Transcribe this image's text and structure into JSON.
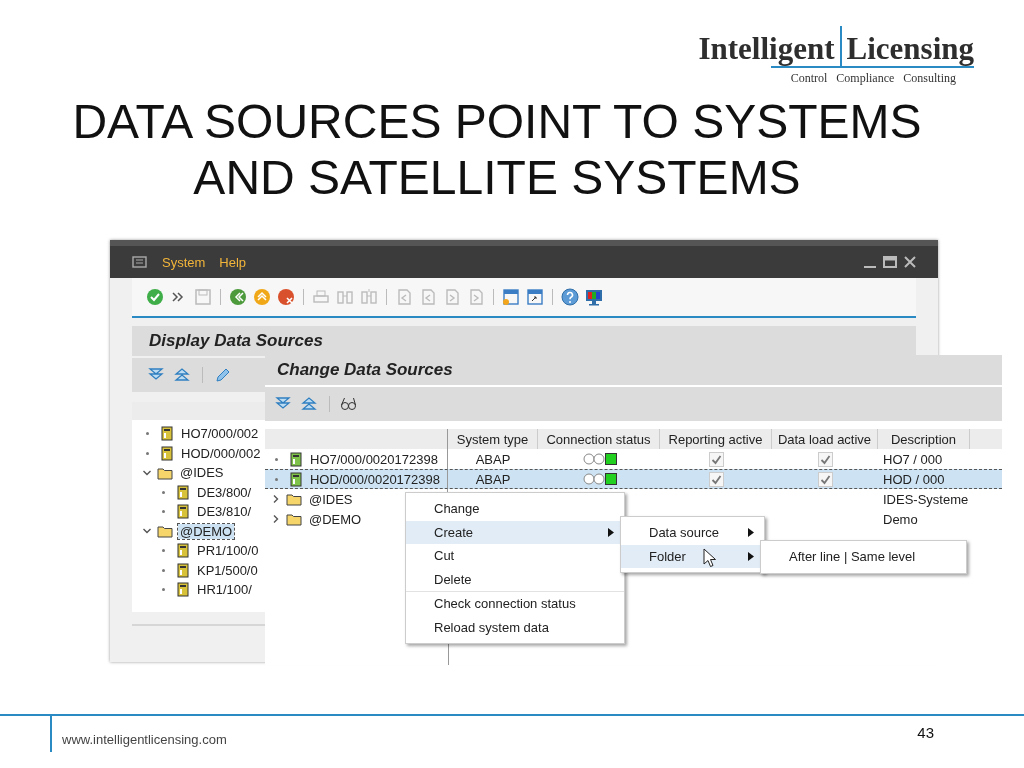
{
  "logo": {
    "name_parts": [
      "Intelligent",
      "Licensing"
    ],
    "tagline": [
      "Control",
      "Compliance",
      "Consulting"
    ]
  },
  "title_lines": [
    "DATA SOURCES POINT TO SYSTEMS",
    "AND SATELLITE SYSTEMS"
  ],
  "back_window": {
    "menu": [
      "System",
      "Help"
    ],
    "heading": "Display Data Sources",
    "tree": [
      {
        "kind": "system",
        "label": "HO7/000/002",
        "selected": false
      },
      {
        "kind": "system",
        "label": "HOD/000/002",
        "selected": false
      },
      {
        "kind": "folder",
        "label": "@IDES",
        "expanded": true,
        "selected": false,
        "children": [
          {
            "kind": "system",
            "label": "DE3/800/",
            "selected": false
          },
          {
            "kind": "system",
            "label": "DE3/810/",
            "selected": false
          }
        ]
      },
      {
        "kind": "folder",
        "label": "@DEMO",
        "expanded": true,
        "selected": true,
        "children": [
          {
            "kind": "system",
            "label": "PR1/100/0",
            "selected": false
          },
          {
            "kind": "system",
            "label": "KP1/500/0",
            "selected": false
          },
          {
            "kind": "system",
            "label": "HR1/100/",
            "selected": false
          }
        ]
      }
    ]
  },
  "front_window": {
    "heading": "Change Data Sources",
    "columns": [
      "System type",
      "Connection status",
      "Reporting active",
      "Data load active",
      "Description"
    ],
    "rows": [
      {
        "kind": "system",
        "label": "HO7/000/0020172398",
        "system_type": "ABAP",
        "connection_status": {
          "color": "#22d022"
        },
        "reporting_active": true,
        "data_load_active": true,
        "description": "HO7 / 000",
        "selected": false
      },
      {
        "kind": "system",
        "label": "HOD/000/0020172398",
        "system_type": "ABAP",
        "connection_status": {
          "color": "#22d022"
        },
        "reporting_active": true,
        "data_load_active": true,
        "description": "HOD / 000",
        "selected": true
      },
      {
        "kind": "folder",
        "label": "@IDES",
        "expanded": false,
        "description": "IDES-Systeme",
        "selected": false
      },
      {
        "kind": "folder",
        "label": "@DEMO",
        "expanded": false,
        "description": "Demo",
        "selected": false
      }
    ]
  },
  "context_menu": {
    "groups": [
      [
        {
          "label": "Change",
          "kind": "action",
          "selected": false
        },
        {
          "label": "Create",
          "kind": "submenu",
          "selected": true
        },
        {
          "label": "Cut",
          "kind": "action",
          "selected": false
        },
        {
          "label": "Delete",
          "kind": "action",
          "selected": false
        }
      ],
      [
        {
          "label": "Check connection status",
          "kind": "action",
          "selected": false
        },
        {
          "label": "Reload system data",
          "kind": "action",
          "selected": false
        }
      ]
    ]
  },
  "submenu": {
    "items": [
      {
        "label": "Data source",
        "kind": "submenu",
        "selected": false
      },
      {
        "label": "Folder",
        "kind": "submenu",
        "selected": true
      }
    ]
  },
  "submenu_2": {
    "items": [
      {
        "label": "After line | Same level",
        "selected": false
      }
    ]
  },
  "footer": {
    "url": "www.intelligentlicensing.com",
    "page_number": "43"
  }
}
